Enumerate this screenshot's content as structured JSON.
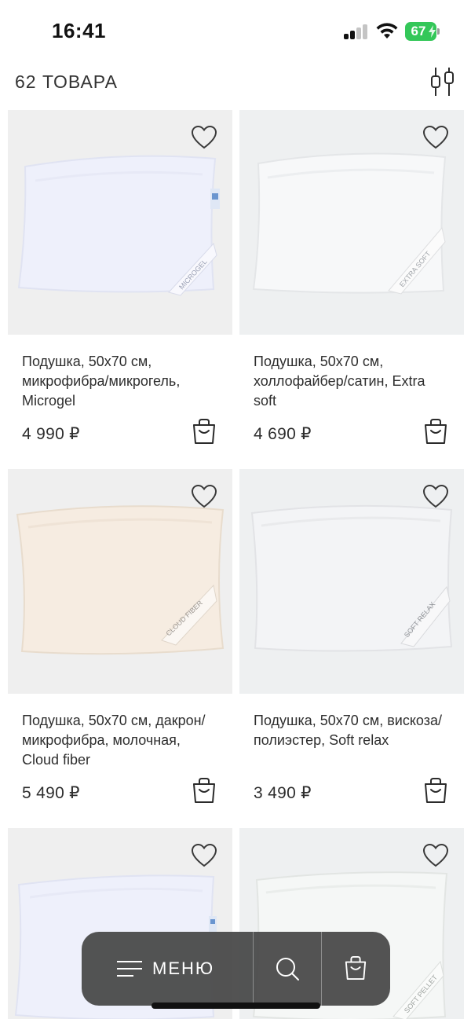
{
  "status_bar": {
    "time": "16:41",
    "battery": "67",
    "battery_color": "#34c759"
  },
  "header": {
    "count_label": "62 ТОВАРА",
    "filter_icon": "sliders-icon"
  },
  "products": [
    {
      "title": "Подушка, 50х70 см, микрофибра/микрогель, Microgel",
      "price": "4 990 ₽",
      "pillow_tint": "#f3f3fb",
      "tag_text": "MICROGEL"
    },
    {
      "title": "Подушка, 50х70 см, холлофайбер/сатин, Extra soft",
      "price": "4 690 ₽",
      "pillow_tint": "#f5f7f8",
      "tag_text": "EXTRA SOFT"
    },
    {
      "title": "Подушка, 50х70 см, дакрон/микрофибра, молочная, Cloud fiber",
      "price": "5 490 ₽",
      "pillow_tint": "#f7efe6",
      "tag_text": "CLOUD FIBER"
    },
    {
      "title": "Подушка, 50х70 см, вискоза/полиэстер, Soft relax",
      "price": "3 490 ₽",
      "pillow_tint": "#f4f4f5",
      "tag_text": "SOFT RELAX"
    },
    {
      "title": "",
      "price": "",
      "pillow_tint": "#f3f3fb",
      "tag_text": ""
    },
    {
      "title": "",
      "price": "",
      "pillow_tint": "#f4f6f5",
      "tag_text": "SOFT PELLET"
    }
  ],
  "bottom_nav": {
    "menu_label": "МЕНЮ",
    "menu_icon": "hamburger-icon",
    "search_icon": "search-icon",
    "cart_icon": "shopping-bag-icon"
  }
}
